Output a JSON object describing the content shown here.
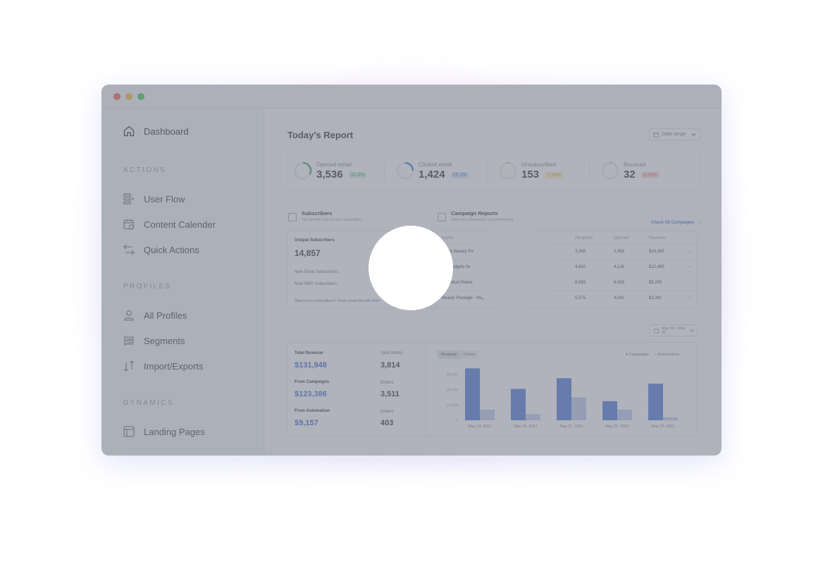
{
  "sidebar": {
    "dashboard": "Dashboard",
    "sections": [
      "ACTIONS",
      "PROFILES",
      "DYNAMICS"
    ],
    "actions": [
      "User Flow",
      "Content Calender",
      "Quick Actions"
    ],
    "profiles": [
      "All Profiles",
      "Segments",
      "Import/Exports"
    ],
    "dynamics": [
      "Landing Pages"
    ]
  },
  "header": {
    "title": "Today's Report",
    "date_range": "Date range"
  },
  "stats": [
    {
      "label": "Opened email",
      "value": "3,536",
      "badge": "32.4%",
      "color": "#2ea36b",
      "badge_bg": "#d7f1e3",
      "fill": 0.324
    },
    {
      "label": "Clicked email",
      "value": "1,424",
      "badge": "25.1%",
      "color": "#3b6fd8",
      "badge_bg": "#dbe6fb",
      "fill": 0.251
    },
    {
      "label": "Unsubscribed",
      "value": "153",
      "badge": "1.14%",
      "color": "#e0a21e",
      "badge_bg": "#fbeccb",
      "fill": 0.0114
    },
    {
      "label": "Bounced",
      "value": "32",
      "badge": "0.09%",
      "color": "#e0584f",
      "badge_bg": "#fadcd9",
      "fill": 0.0009
    }
  ],
  "subscribers": {
    "title": "Subscribers",
    "subtitle": "The growth rate of your subscribers",
    "unique_label": "Unique Subscribers",
    "unique_value": "14,857",
    "new_email": "New Email Subscribers",
    "new_sms": "New SMS Subscribers",
    "footer": "Want more subscribers? Grow email list with",
    "footer_link": "form"
  },
  "campaigns": {
    "title": "Campaign Reports",
    "subtitle": "How your campaigns are performing",
    "check_all": "Check All Campaigns",
    "headers": [
      "Name",
      "Recipient",
      "Opened",
      "Revenue"
    ],
    "rows": [
      {
        "name": "ohora Beauty Package - June",
        "recipient": "3,386",
        "opened": "2,493",
        "revenue": "$14,385",
        "menu": true
      },
      {
        "name": "ing Gadgets for Young People",
        "recipient": "4,692",
        "opened": "4,126",
        "revenue": "$12,490",
        "menu": true
      },
      {
        "name": "y Product Released on May",
        "recipient": "8,583",
        "opened": "6,583",
        "revenue": "$5,205",
        "menu": false
      },
      {
        "name": "Beauty Package - May",
        "recipient": "5,575",
        "opened": "4,042",
        "revenue": "$3,391",
        "menu": true
      }
    ]
  },
  "revenue": {
    "date_range": "May 19 - May 25",
    "total_revenue_label": "Total Revenue",
    "total_revenue": "$131,948",
    "total_orders_label": "Total orders",
    "total_orders": "3,814",
    "campaigns_label": "From Campaigns",
    "campaigns_revenue": "$123,386",
    "campaigns_orders_label": "Orders",
    "campaigns_orders": "3,511",
    "automation_label": "From Automation",
    "automation_revenue": "$9,157",
    "automation_orders_label": "Orders",
    "automation_orders": "403",
    "tabs": [
      "Revenue",
      "Orders"
    ]
  },
  "chart_data": {
    "type": "bar",
    "categories": [
      "May 19, 2021",
      "May 20, 2021",
      "May 21, 2021",
      "May 22, 2021",
      "May 23, 2021"
    ],
    "series": [
      {
        "name": "Campaigns",
        "values": [
          34000,
          20500,
          27500,
          12500,
          24000
        ],
        "color": "#3f6fd8"
      },
      {
        "name": "Automations",
        "values": [
          7000,
          4000,
          15000,
          7000,
          2000
        ],
        "color": "#b7c8ef"
      }
    ],
    "ylim": [
      0,
      36000
    ],
    "yticks": [
      0,
      10000,
      20000,
      30000
    ],
    "ytick_labels": [
      "0",
      "10,000",
      "20,000",
      "30,000"
    ]
  }
}
